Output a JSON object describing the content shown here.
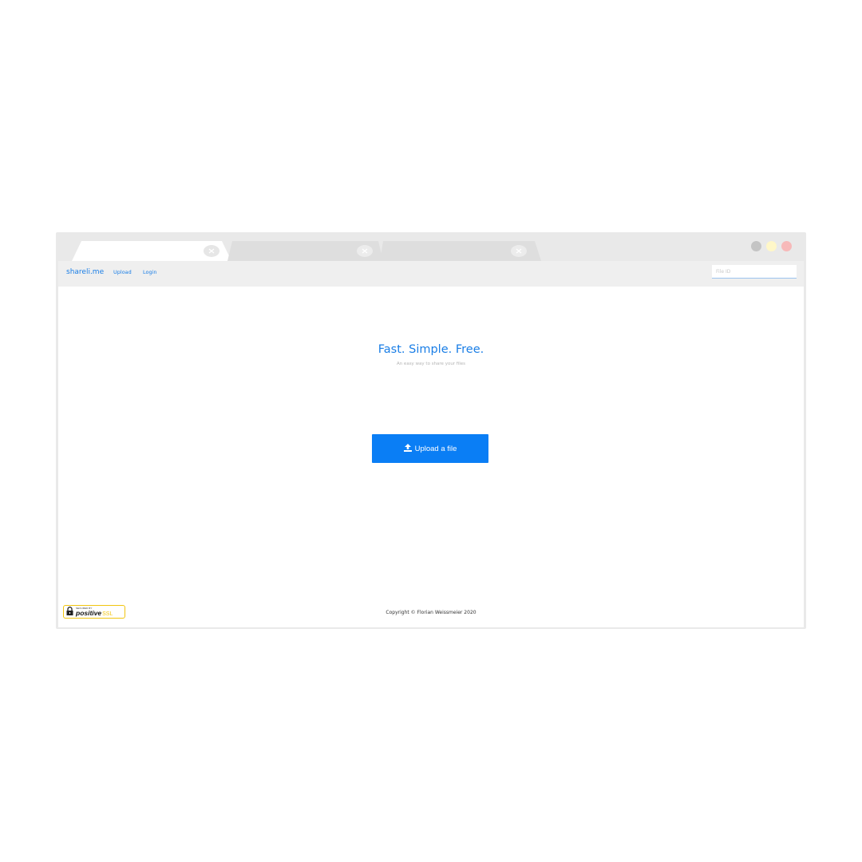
{
  "colors": {
    "accent": "#1a7ee6",
    "button": "#0a7ef5",
    "chrome": "#e9e9e9",
    "win_dot_1": "#c4c4c4",
    "win_dot_2": "#fff7c8",
    "win_dot_3": "#f7b9b9"
  },
  "icons": {
    "tab_close": "close-icon",
    "upload": "upload-icon",
    "ssl_lock": "lock-icon"
  },
  "navbar": {
    "brand": "shareli.me",
    "links": [
      "Upload",
      "Login"
    ],
    "search_placeholder": "File ID"
  },
  "hero": {
    "title": "Fast. Simple. Free.",
    "subtitle": "An easy way to share your files"
  },
  "upload_button": {
    "label": "Upload a file"
  },
  "ssl_badge": {
    "small": "SECURED BY",
    "brand": "positive",
    "suffix": "SSL"
  },
  "footer": {
    "copyright": "Copyright © Florian Weissmeier 2020"
  }
}
